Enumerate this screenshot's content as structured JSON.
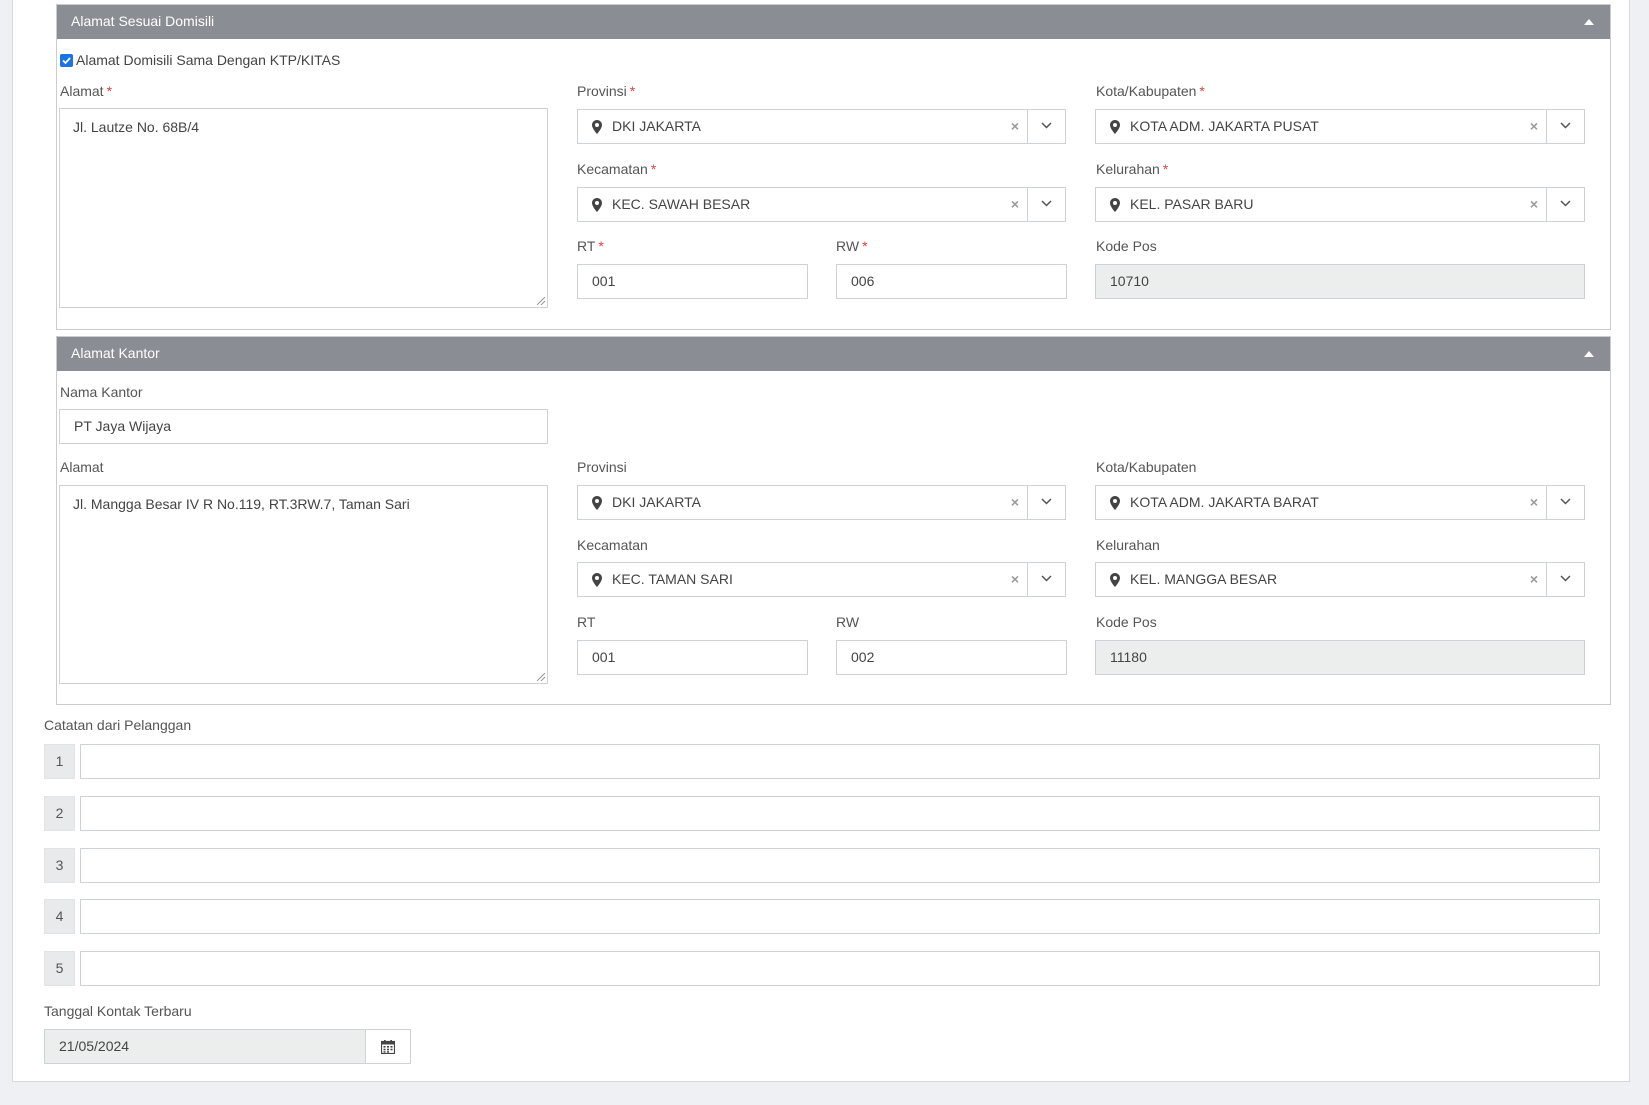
{
  "domisili": {
    "title": "Alamat Sesuai Domisili",
    "same_as_ktp_label": "Alamat Domisili Sama Dengan KTP/KITAS",
    "same_as_ktp_checked": true,
    "alamat_label": "Alamat",
    "alamat_value": "Jl. Lautze No. 68B/4",
    "provinsi_label": "Provinsi",
    "provinsi_value": "DKI JAKARTA",
    "kota_label": "Kota/Kabupaten",
    "kota_value": "KOTA ADM. JAKARTA PUSAT",
    "kecamatan_label": "Kecamatan",
    "kecamatan_value": "KEC. SAWAH BESAR",
    "kelurahan_label": "Kelurahan",
    "kelurahan_value": "KEL. PASAR BARU",
    "rt_label": "RT",
    "rt_value": "001",
    "rw_label": "RW",
    "rw_value": "006",
    "kodepos_label": "Kode Pos",
    "kodepos_value": "10710",
    "required_mark": "*"
  },
  "kantor": {
    "title": "Alamat Kantor",
    "nama_label": "Nama Kantor",
    "nama_value": "PT Jaya Wijaya",
    "alamat_label": "Alamat",
    "alamat_value": "Jl. Mangga Besar IV R No.119, RT.3RW.7, Taman Sari",
    "provinsi_label": "Provinsi",
    "provinsi_value": "DKI JAKARTA",
    "kota_label": "Kota/Kabupaten",
    "kota_value": "KOTA ADM. JAKARTA BARAT",
    "kecamatan_label": "Kecamatan",
    "kecamatan_value": "KEC. TAMAN SARI",
    "kelurahan_label": "Kelurahan",
    "kelurahan_value": "KEL. MANGGA BESAR",
    "rt_label": "RT",
    "rt_value": "001",
    "rw_label": "RW",
    "rw_value": "002",
    "kodepos_label": "Kode Pos",
    "kodepos_value": "11180"
  },
  "catatan": {
    "label": "Catatan dari Pelanggan",
    "rows": [
      "1",
      "2",
      "3",
      "4",
      "5"
    ]
  },
  "kontak": {
    "label": "Tanggal Kontak Terbaru",
    "value": "21/05/2024"
  },
  "icons": {
    "pin": "map-marker-icon",
    "clear": "times-icon",
    "dropdown": "chevron-down-icon",
    "collapse": "caret-up-icon",
    "calendar": "calendar-icon"
  },
  "colors": {
    "panel_header": "#8a8d94",
    "required": "#e04040",
    "readonly_bg": "#eceded",
    "checkbox": "#1a73e8"
  }
}
